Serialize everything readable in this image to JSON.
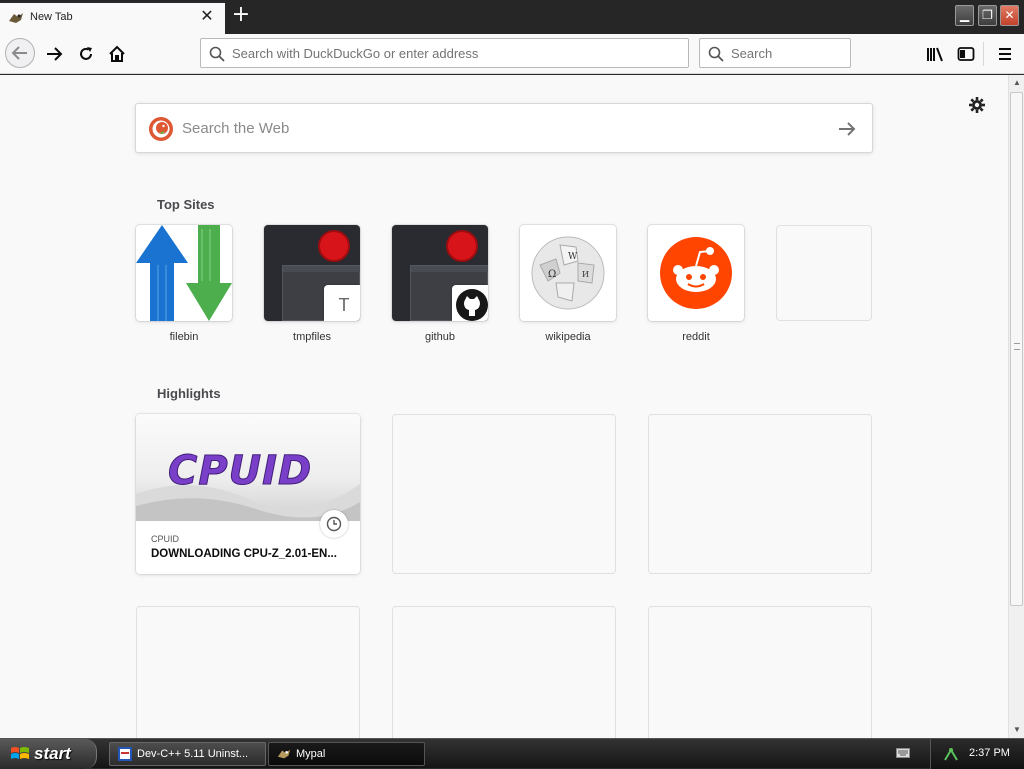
{
  "browser": {
    "tab": {
      "title": "New Tab",
      "close_symbol": "✕"
    },
    "new_tab_symbol": "+",
    "window_controls": {
      "minimize": "▁",
      "restore": "❐",
      "close": "✕"
    },
    "urlbar": {
      "placeholder": "Search with DuckDuckGo or enter address"
    },
    "searchbar": {
      "placeholder": "Search"
    }
  },
  "newtab": {
    "web_search": {
      "placeholder": "Search the Web"
    },
    "top_sites_title": "Top Sites",
    "top_sites": [
      {
        "label": "filebin",
        "icon": "filebin-arrows-icon"
      },
      {
        "label": "tmpfiles",
        "icon": "screenshot-thumbnail",
        "badge": "T"
      },
      {
        "label": "github",
        "icon": "screenshot-thumbnail",
        "badge_icon": "github-icon"
      },
      {
        "label": "wikipedia",
        "icon": "wikipedia-globe-icon"
      },
      {
        "label": "reddit",
        "icon": "reddit-alien-icon"
      }
    ],
    "highlights_title": "Highlights",
    "highlights": [
      {
        "image_text": "CPUID",
        "source": "CPUID",
        "title": "DOWNLOADING CPU-Z_2.01-EN..."
      }
    ]
  },
  "taskbar": {
    "start_label": "start",
    "tasks": [
      {
        "label": "Dev-C++ 5.11 Uninst..."
      },
      {
        "label": "Mypal"
      }
    ],
    "clock": "2:37 PM"
  },
  "colors": {
    "reddit": "#ff4500",
    "filebin_up": "#1a73d0",
    "filebin_down": "#4cae4c",
    "cpuid_purple": "#7a3fc8",
    "ddg_orange": "#de5833"
  }
}
